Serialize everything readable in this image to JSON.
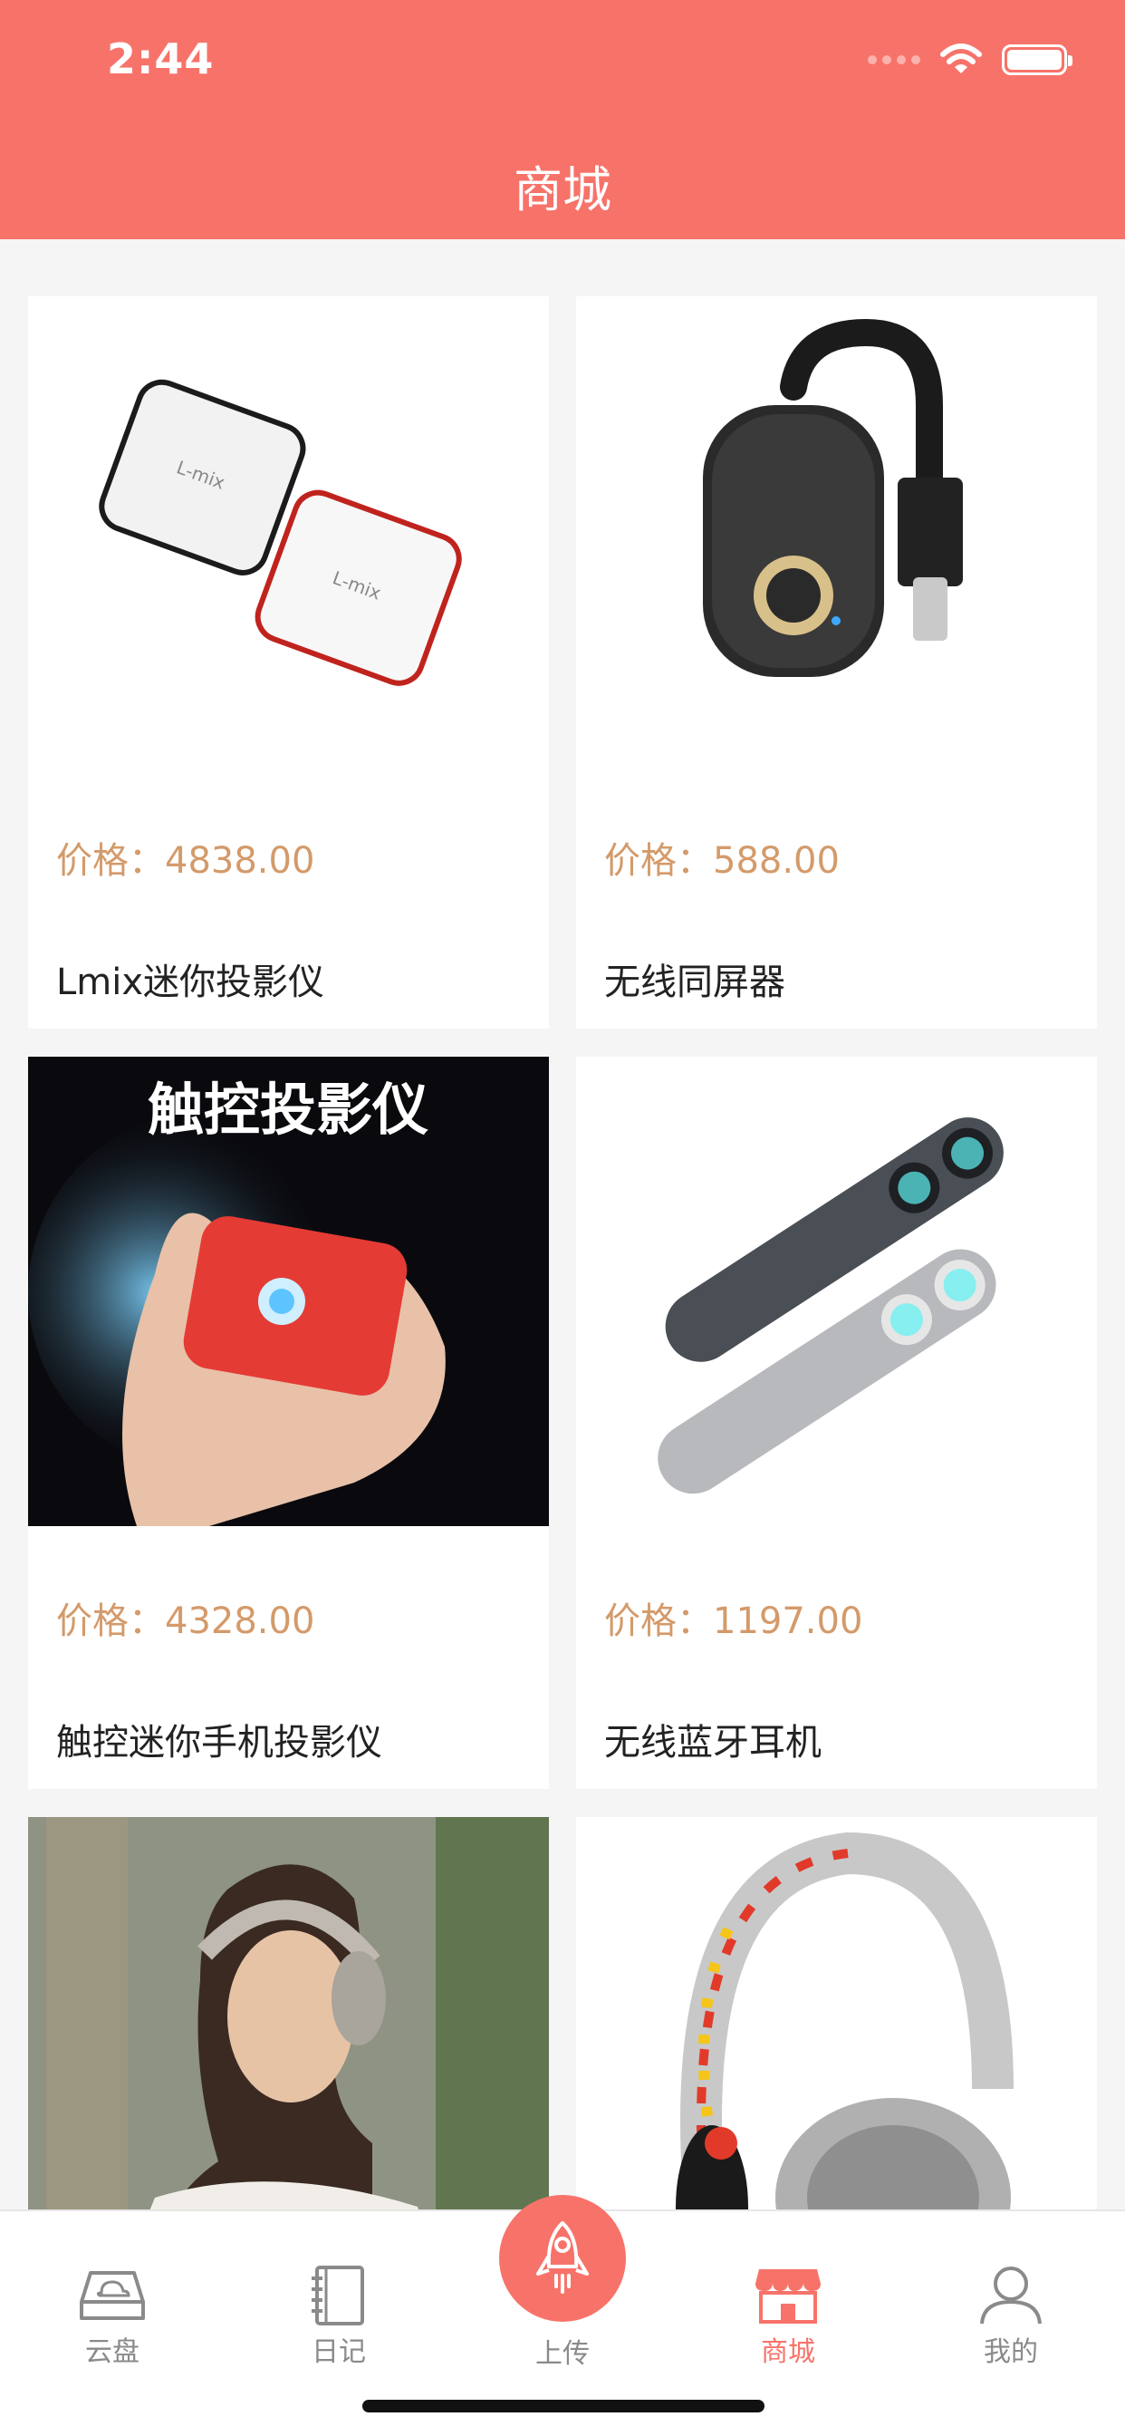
{
  "status_bar": {
    "time": "2:44"
  },
  "header": {
    "title": "商城"
  },
  "products": [
    {
      "price": "价格：4838.00",
      "name": "Lmix迷你投影仪",
      "image": "mini-projector-lmix"
    },
    {
      "price": "价格：588.00",
      "name": "无线同屏器",
      "image": "wireless-screen-dongle"
    },
    {
      "price": "价格：4328.00",
      "name": "触控迷你手机投影仪",
      "image": "touch-projector",
      "image_text": "触控投影仪"
    },
    {
      "price": "价格：1197.00",
      "name": "无线蓝牙耳机",
      "image": "bluetooth-earbuds"
    },
    {
      "price": "",
      "name": "",
      "image": "woman-headphones-photo"
    },
    {
      "price": "",
      "name": "",
      "image": "mickey-headphones"
    }
  ],
  "tabbar": {
    "items": [
      {
        "label": "云盘",
        "icon": "cloud-disk-icon"
      },
      {
        "label": "日记",
        "icon": "notebook-icon"
      },
      {
        "label": "上传",
        "icon": "rocket-icon"
      },
      {
        "label": "商城",
        "icon": "shop-icon",
        "active": true
      },
      {
        "label": "我的",
        "icon": "user-icon"
      }
    ]
  },
  "colors": {
    "accent": "#f7736a",
    "price": "#d49a6a",
    "background": "#f5f5f5"
  }
}
